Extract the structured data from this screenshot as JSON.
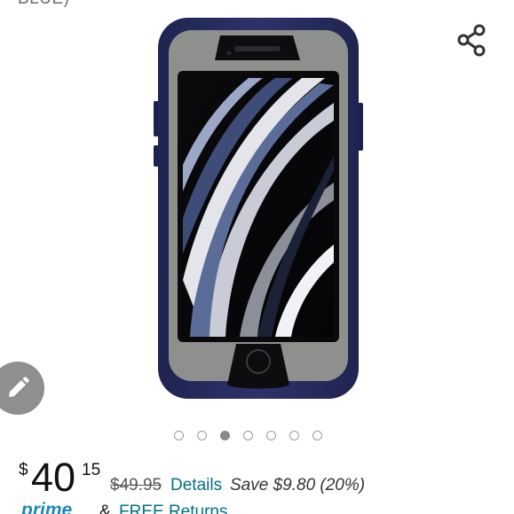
{
  "header": {
    "cut_title": "BLUE)"
  },
  "product": {
    "image_alt": "OtterBox Defender phone case in blue and grey",
    "carousel": {
      "total": 7,
      "active_index": 2
    }
  },
  "price": {
    "currency_symbol": "$",
    "whole": "40",
    "fraction": "15",
    "list_price": "$49.95",
    "details_label": "Details",
    "savings": "Save $9.80 (20%)"
  },
  "shipping": {
    "prime_label": "prime",
    "ampersand": "&",
    "free_returns_label": "FREE Returns"
  },
  "icons": {
    "share": "share-icon",
    "edit": "pencil-icon"
  },
  "colors": {
    "link": "#007185",
    "prime": "#1e88b8",
    "case_blue": "#272d5f",
    "case_grey": "#8f918e"
  }
}
